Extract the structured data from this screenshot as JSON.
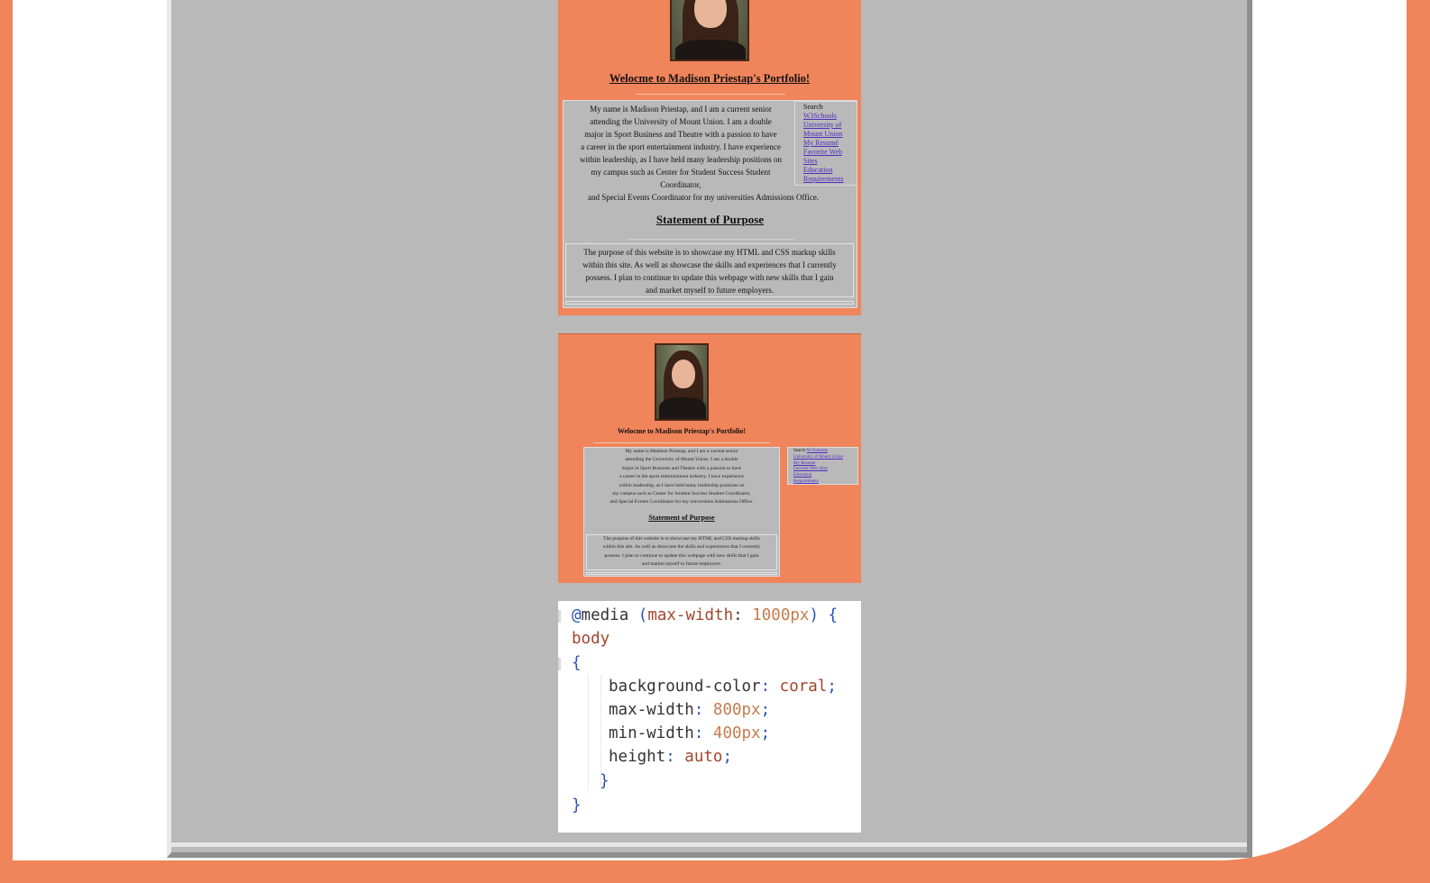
{
  "shot1": {
    "title": "Welocme to Madison Priestap's Portfolio!",
    "intro_lines": [
      "My name is Madison Priestap, and I am a current senior",
      "attending the University of Mount Union. I am a double",
      "major in Sport Business and Theatre with a passion to have",
      "a career in the sport entertainment industry. I have experience",
      "within leadership, as I have held many leadership positions on",
      "my campus such as Center for Student Success Student",
      "Coordinator,"
    ],
    "intro_last": "and Special Events Coordinator for my universities Admissions Office.",
    "sidebar": {
      "heading": "Search",
      "links": [
        "W3Schools",
        "University of",
        "Mount Union",
        "My Resumé",
        "Favorite Web",
        "Sites",
        "Education",
        "Requirements"
      ]
    },
    "statement_heading": "Statement of Purpose",
    "purpose_lines": [
      "The purpose of this website is to showcase my HTML and CSS markup skills",
      "within this site. As well as showcase the skills and experiences that I currently",
      "possess. I plan to continue to update this webpage with new skills that I gain",
      "and market myself to future employers."
    ]
  },
  "shot2": {
    "title": "Welocme to Madison Priestap's Portfolio!",
    "intro_lines": [
      "My name is Madison Priestap, and I am a current senior",
      "attending the University of Mount Union. I am a double",
      "major in Sport Business and Theatre with a passion to have",
      "a career in the sport entertainment industry. I have experience",
      "within leadership, as I have held many leadership positions on",
      "my campus such as Center for Student Success Student Coordinator,",
      "and Special Events Coordinator for my universities Admissions Office."
    ],
    "sidebar": {
      "heading": "Search",
      "links": [
        "W3Schools",
        "University of Mount Union",
        "My Resumé",
        "Favorite Web Sites",
        "Education",
        "Requirements"
      ]
    },
    "statement_heading": "Statement of Purpose",
    "purpose_lines": [
      "The purpose of this website is to showcase my HTML and CSS markup skills",
      "within this site. As well as showcase the skills and experiences that I currently",
      "possess. I plan to continue to update this webpage with new skills that I gain",
      "and market myself to future employers."
    ]
  },
  "code": {
    "at": "@",
    "media_kw": "media",
    "paren_open": " (",
    "prop0": "max-width",
    "colon": ": ",
    "val0": "1000px",
    "paren_close": ") {",
    "selector": "body",
    "brace_open": "{",
    "props": [
      {
        "name": "background-color",
        "value": "coral"
      },
      {
        "name": "max-width",
        "value": "800px"
      },
      {
        "name": "min-width",
        "value": "400px"
      },
      {
        "name": "height",
        "value": "auto"
      }
    ],
    "semicolon": ";",
    "inner_close": "}",
    "outer_close": "}"
  },
  "colors": {
    "coral_bg": "#F0845A",
    "page_gray": "#B9B9B9",
    "link": "#4B2FBF"
  }
}
